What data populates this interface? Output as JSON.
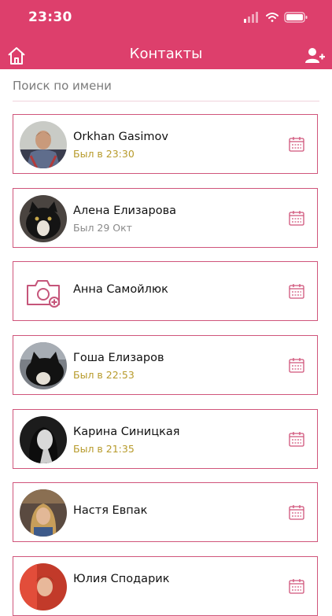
{
  "status_bar": {
    "time": "23:30"
  },
  "nav": {
    "title": "Контакты",
    "home_icon": "home-icon",
    "add_icon": "add-user-icon"
  },
  "search": {
    "placeholder": "Поиск по имени"
  },
  "colors": {
    "accent": "#dd3f6c",
    "border": "#d0557b",
    "online": "#b79a2a",
    "offline": "#8a8a8a"
  },
  "contacts": [
    {
      "name": "Orkhan Gasimov",
      "status": "Был в 23:30"
    },
    {
      "name": "Алена Елизарова",
      "status": "Был 29 Окт"
    },
    {
      "name": "Анна Самойлюк",
      "status": ""
    },
    {
      "name": "Гоша Елизаров",
      "status": "Был в 22:53"
    },
    {
      "name": "Карина Синицкая",
      "status": "Был в 21:35"
    },
    {
      "name": "Настя Евпак",
      "status": ""
    },
    {
      "name": "Юлия Сподарик",
      "status": ""
    }
  ]
}
